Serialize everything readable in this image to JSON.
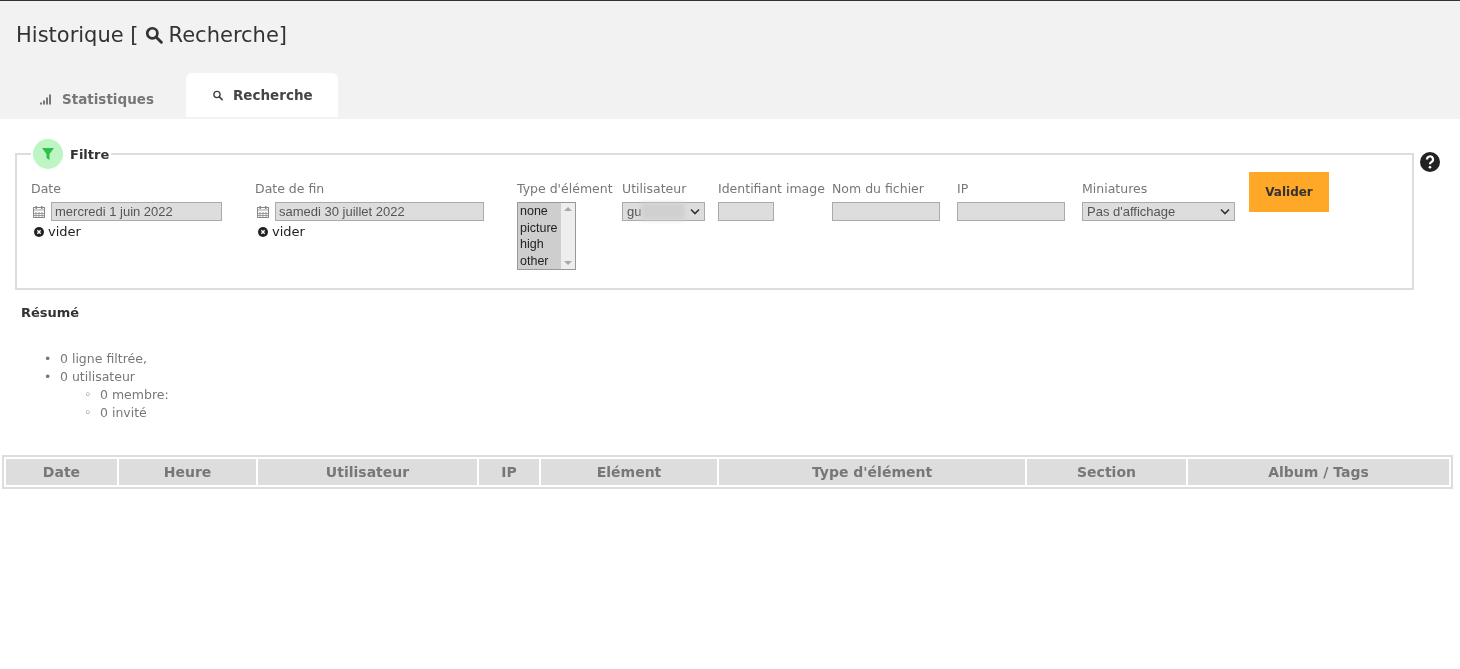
{
  "page_title": {
    "before": "Historique [",
    "after": "Recherche]"
  },
  "tabs": [
    {
      "label": "Statistiques",
      "kind": "chart",
      "selected": false
    },
    {
      "label": "Recherche",
      "kind": "search",
      "selected": true
    }
  ],
  "filter": {
    "legend": "Filtre",
    "date": {
      "label": "Date",
      "value": "mercredi 1 juin 2022",
      "clear": "vider"
    },
    "end_date": {
      "label": "Date de fin",
      "value": "samedi 30 juillet 2022",
      "clear": "vider"
    },
    "element_type": {
      "label": "Type d'élément",
      "options": [
        {
          "label": "none",
          "selected": true
        },
        {
          "label": "picture",
          "selected": true
        },
        {
          "label": "high",
          "selected": true
        },
        {
          "label": "other",
          "selected": true
        }
      ]
    },
    "user": {
      "label": "Utilisateur",
      "value": "gu"
    },
    "image_id": {
      "label": "Identifiant image"
    },
    "filename": {
      "label": "Nom du fichier"
    },
    "ip": {
      "label": "IP"
    },
    "thumbnails": {
      "label": "Miniatures",
      "value": "Pas d'affichage"
    },
    "submit": "Valider"
  },
  "summary": {
    "title": "Résumé",
    "items": [
      {
        "marker": "•",
        "text": "0 ligne filtrée,"
      },
      {
        "marker": "•",
        "text": "0 utilisateur",
        "children": [
          {
            "marker": "◦",
            "text": "0 membre:"
          },
          {
            "marker": "◦",
            "text": "0 invité"
          }
        ]
      }
    ]
  },
  "table": {
    "columns": [
      "Date",
      "Heure",
      "Utilisateur",
      "IP",
      "Elément",
      "Type d'élément",
      "Section",
      "Album / Tags"
    ]
  }
}
